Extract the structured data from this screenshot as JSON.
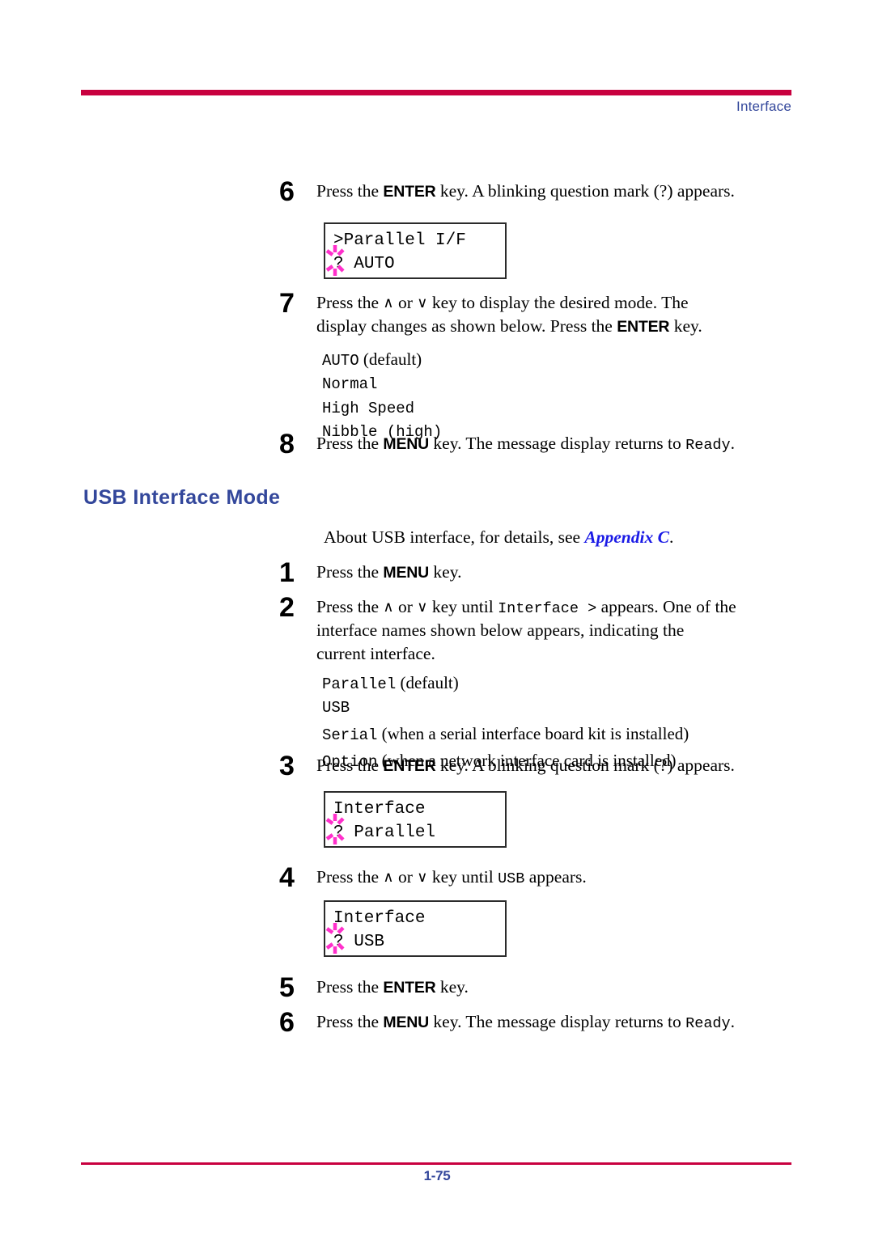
{
  "header": {
    "label": "Interface",
    "rule_color": "#C8003F"
  },
  "footer": {
    "page_number": "1-75",
    "rule_color": "#C8003F",
    "text_color": "#33479B"
  },
  "section": {
    "heading": "USB Interface Mode",
    "heading_color": "#33479B"
  },
  "intro": {
    "before_link": "About USB interface, for details, see ",
    "link_text": "Appendix C",
    "after_link": ".",
    "link_color": "#1A1AE6"
  },
  "steps": {
    "parallel_6": {
      "number": "6",
      "t1": "Press the ",
      "key": "ENTER",
      "t2": " key. A blinking question mark (?) appears."
    },
    "parallel_7": {
      "number": "7",
      "t1": "Press the ",
      "up": "∧",
      "t2": " or ",
      "down": "∨",
      "t3": " key to display the desired mode. The display changes as shown below. Press the ",
      "key": "ENTER",
      "t4": " key."
    },
    "parallel_8": {
      "number": "8",
      "t1": "Press the ",
      "key": "MENU",
      "t2": " key. The message display returns to ",
      "mono": "Ready",
      "t3": "."
    },
    "usb_1": {
      "number": "1",
      "t1": "Press the ",
      "key": "MENU",
      "t2": " key."
    },
    "usb_2": {
      "number": "2",
      "t1": "Press the ",
      "up": "∧",
      "t2": " or ",
      "down": "∨",
      "t3": " key until ",
      "mono": "Interface  >",
      "t4": " appears. One of the interface names shown below appears, indicating the current interface."
    },
    "usb_3": {
      "number": "3",
      "t1": "Press the ",
      "key": "ENTER",
      "t2": " key. A blinking question mark (?) appears."
    },
    "usb_4": {
      "number": "4",
      "t1": "Press the ",
      "up": "∧",
      "t2": " or ",
      "down": "∨",
      "t3": " key until ",
      "mono": "USB",
      "t4": " appears."
    },
    "usb_5": {
      "number": "5",
      "t1": "Press the ",
      "key": "ENTER",
      "t2": " key."
    },
    "usb_6": {
      "number": "6",
      "t1": "Press the ",
      "key": "MENU",
      "t2": " key. The message display returns to ",
      "mono": "Ready",
      "t3": "."
    }
  },
  "mode_list": {
    "item1_mono": "AUTO",
    "item1_note": " (default)",
    "item2_mono": "Normal",
    "item3_mono": "High Speed",
    "item4_mono": "Nibble (high)"
  },
  "interface_list": {
    "item1_mono": "Parallel",
    "item1_note": " (default)",
    "item2_mono": "USB",
    "item3_mono": "Serial",
    "item3_note": " (when a serial interface board kit is installed)",
    "item4_mono": "Option",
    "item4_note": " (when a network interface card is installed)"
  },
  "lcd_panels": {
    "panel1": {
      "line1": ">Parallel I/F",
      "cursor": "?",
      "line2_rest": " AUTO"
    },
    "panel2": {
      "line1": "Interface",
      "cursor": "?",
      "line2_rest": " Parallel"
    },
    "panel3": {
      "line1": "Interface",
      "cursor": "?",
      "line2_rest": " USB"
    },
    "blink_color": "#FF2FCB",
    "border_color": "#2b2b2b"
  }
}
